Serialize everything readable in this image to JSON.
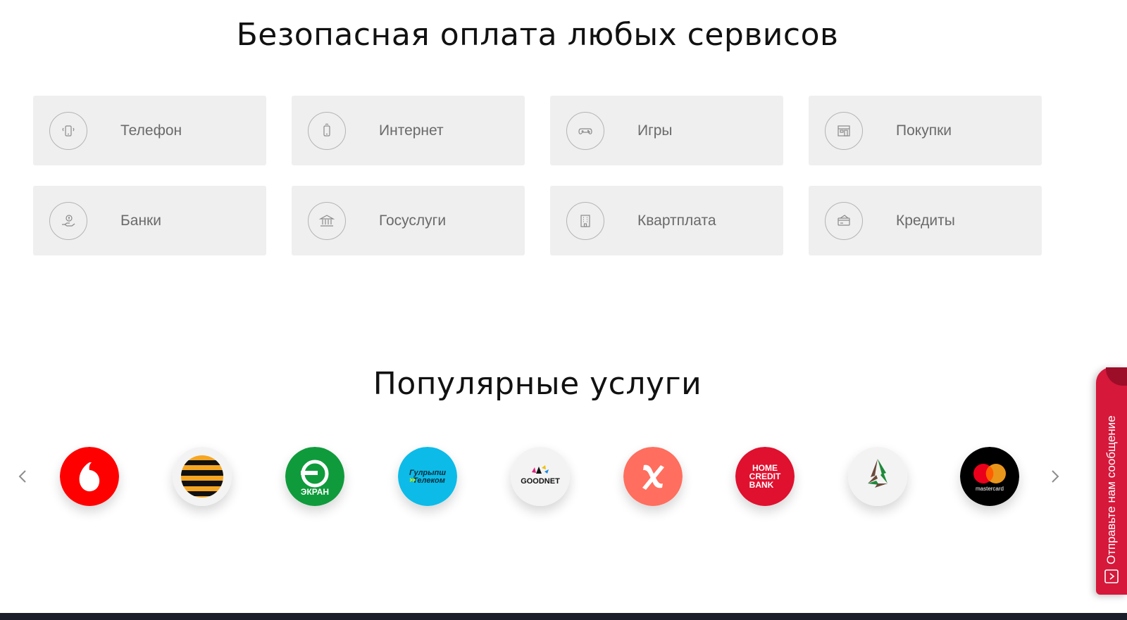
{
  "services": {
    "title": "Безопасная оплата любых сервисов",
    "items": [
      {
        "label": "Телефон",
        "icon": "phone-icon"
      },
      {
        "label": "Интернет",
        "icon": "mobile-internet-icon"
      },
      {
        "label": "Игры",
        "icon": "gamepad-icon"
      },
      {
        "label": "Покупки",
        "icon": "shop-icon"
      },
      {
        "label": "Банки",
        "icon": "hand-coin-icon"
      },
      {
        "label": "Госуслуги",
        "icon": "government-building-icon"
      },
      {
        "label": "Квартплата",
        "icon": "apartment-building-icon"
      },
      {
        "label": "Кредиты",
        "icon": "credit-card-icon"
      }
    ]
  },
  "popular": {
    "title": "Популярные услуги",
    "logos": [
      {
        "name": "vodafone-logo",
        "bg": "#ff0000"
      },
      {
        "name": "beeline-logo",
        "bg": "#f3f3f3"
      },
      {
        "name": "ekran-logo",
        "bg": "#0f9b3c",
        "text": "ЭКРАН"
      },
      {
        "name": "gulrypsh-telecom-logo",
        "bg": "#0cbbe8",
        "text_line1": "Гулрыпш",
        "text_line2": "Телеком"
      },
      {
        "name": "goodnet-logo",
        "bg": "#f3f3f3",
        "text": "GOODNET"
      },
      {
        "name": "x-logo",
        "bg": "#ff6e5e"
      },
      {
        "name": "home-credit-bank-logo",
        "bg": "#e0102f",
        "text_line1": "HOME",
        "text_line2": "CREDIT",
        "text_line3": "BANK"
      },
      {
        "name": "triangle-bank-logo",
        "bg": "#f3f3f3"
      },
      {
        "name": "mastercard-logo",
        "bg": "#000000",
        "text": "mastercard"
      }
    ]
  },
  "feedback": {
    "label": "Отправьте нам сообщение"
  },
  "colors": {
    "card_bg": "#efefef",
    "card_text": "#6a6a6a",
    "accent": "#d6183b"
  }
}
